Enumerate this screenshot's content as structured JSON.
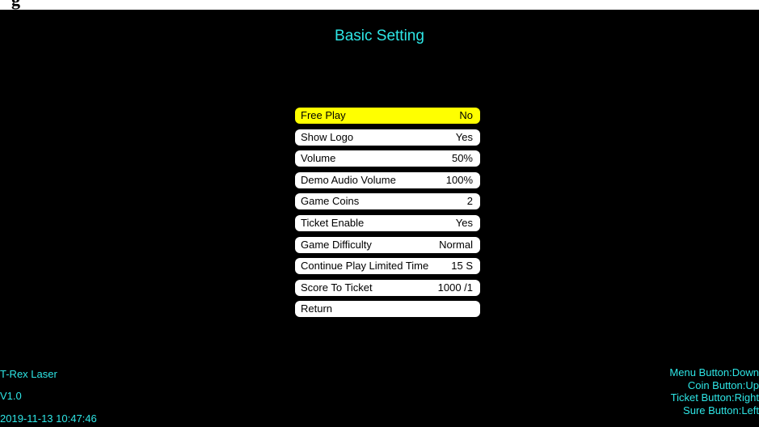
{
  "screen": {
    "title": "Basic Setting",
    "menu": [
      {
        "label": "Free Play",
        "value": "No",
        "selected": true
      },
      {
        "label": "Show Logo",
        "value": "Yes",
        "selected": false
      },
      {
        "label": "Volume",
        "value": "50%",
        "selected": false
      },
      {
        "label": "Demo Audio Volume",
        "value": "100%",
        "selected": false
      },
      {
        "label": "Game Coins",
        "value": "2",
        "selected": false
      },
      {
        "label": "Ticket Enable",
        "value": "Yes",
        "selected": false
      },
      {
        "label": "Game Difficulty",
        "value": "Normal",
        "selected": false
      },
      {
        "label": "Continue Play Limited Time",
        "value": "15 S",
        "selected": false
      },
      {
        "label": "Score To Ticket",
        "value": "1000 /1",
        "selected": false
      },
      {
        "label": "Return",
        "value": "",
        "selected": false
      }
    ],
    "game_name": "T-Rex Laser",
    "version": "V1.0",
    "datetime": "2019-11-13 10:47:46",
    "help": [
      "Menu Button:Down",
      "Coin Button:Up",
      "Ticket Button:Right",
      "Sure Button:Left"
    ]
  },
  "colors": {
    "background": "#000000",
    "text_accent": "#2ee6e6",
    "item_bg": "#ffffff",
    "item_selected_bg": "#ffff00"
  }
}
